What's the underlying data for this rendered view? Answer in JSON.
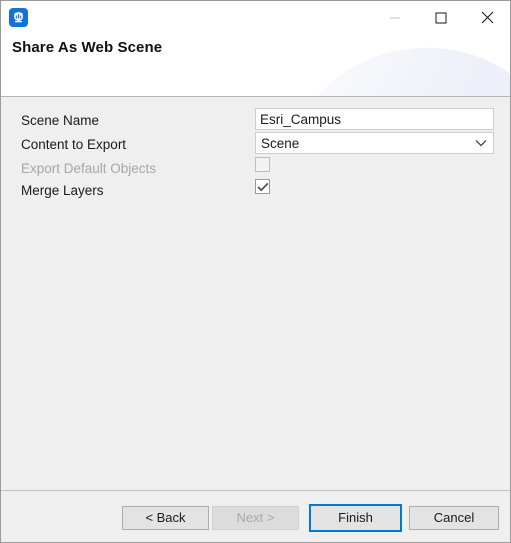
{
  "window": {
    "app_icon_name": "arcgis-pro-icon",
    "title": "Share As Web Scene",
    "controls": {
      "minimize": "—",
      "maximize": "☐",
      "close": "✕"
    },
    "accent_color": "#0078d7",
    "icon_color": "#1671d4",
    "body_background": "#efefef"
  },
  "form": {
    "rows": [
      {
        "label": "Scene Name",
        "type": "text",
        "value": "Esri_Campus",
        "placeholder": "",
        "disabled": false
      },
      {
        "label": "Content to Export",
        "type": "combo",
        "value": "Scene",
        "disabled": false
      },
      {
        "label": "Export Default Objects",
        "type": "checkbox",
        "checked": false,
        "disabled": true
      },
      {
        "label": "Merge Layers",
        "type": "checkbox",
        "checked": true,
        "disabled": false
      }
    ]
  },
  "footer": {
    "buttons": [
      {
        "label": "< Back",
        "disabled": false,
        "default": false
      },
      {
        "label": "Next >",
        "disabled": true,
        "default": false
      },
      {
        "label": "Finish",
        "disabled": false,
        "default": true
      },
      {
        "label": "Cancel",
        "disabled": false,
        "default": false
      }
    ]
  }
}
